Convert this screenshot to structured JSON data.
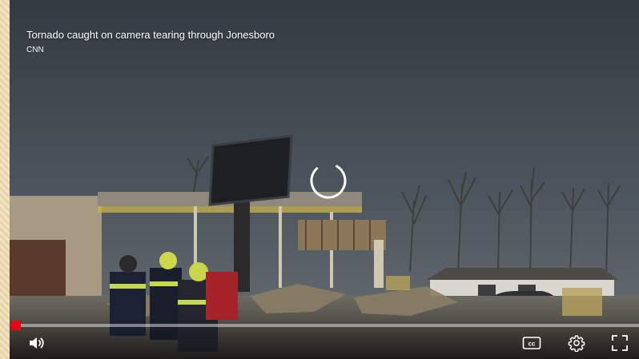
{
  "video": {
    "title": "Tornado caught on camera tearing through Jonesboro",
    "source": "CNN"
  },
  "player": {
    "state": "loading",
    "progress": 0.01,
    "colors": {
      "accent": "#e50914",
      "icon": "#ffffff"
    }
  },
  "controls": {
    "left": [
      {
        "name": "volume-button",
        "icon": "volume-icon"
      }
    ],
    "right": [
      {
        "name": "captions-button",
        "icon": "cc-icon",
        "label": "cc"
      },
      {
        "name": "settings-button",
        "icon": "gear-icon"
      },
      {
        "name": "fullscreen-button",
        "icon": "fullscreen-icon"
      }
    ]
  }
}
